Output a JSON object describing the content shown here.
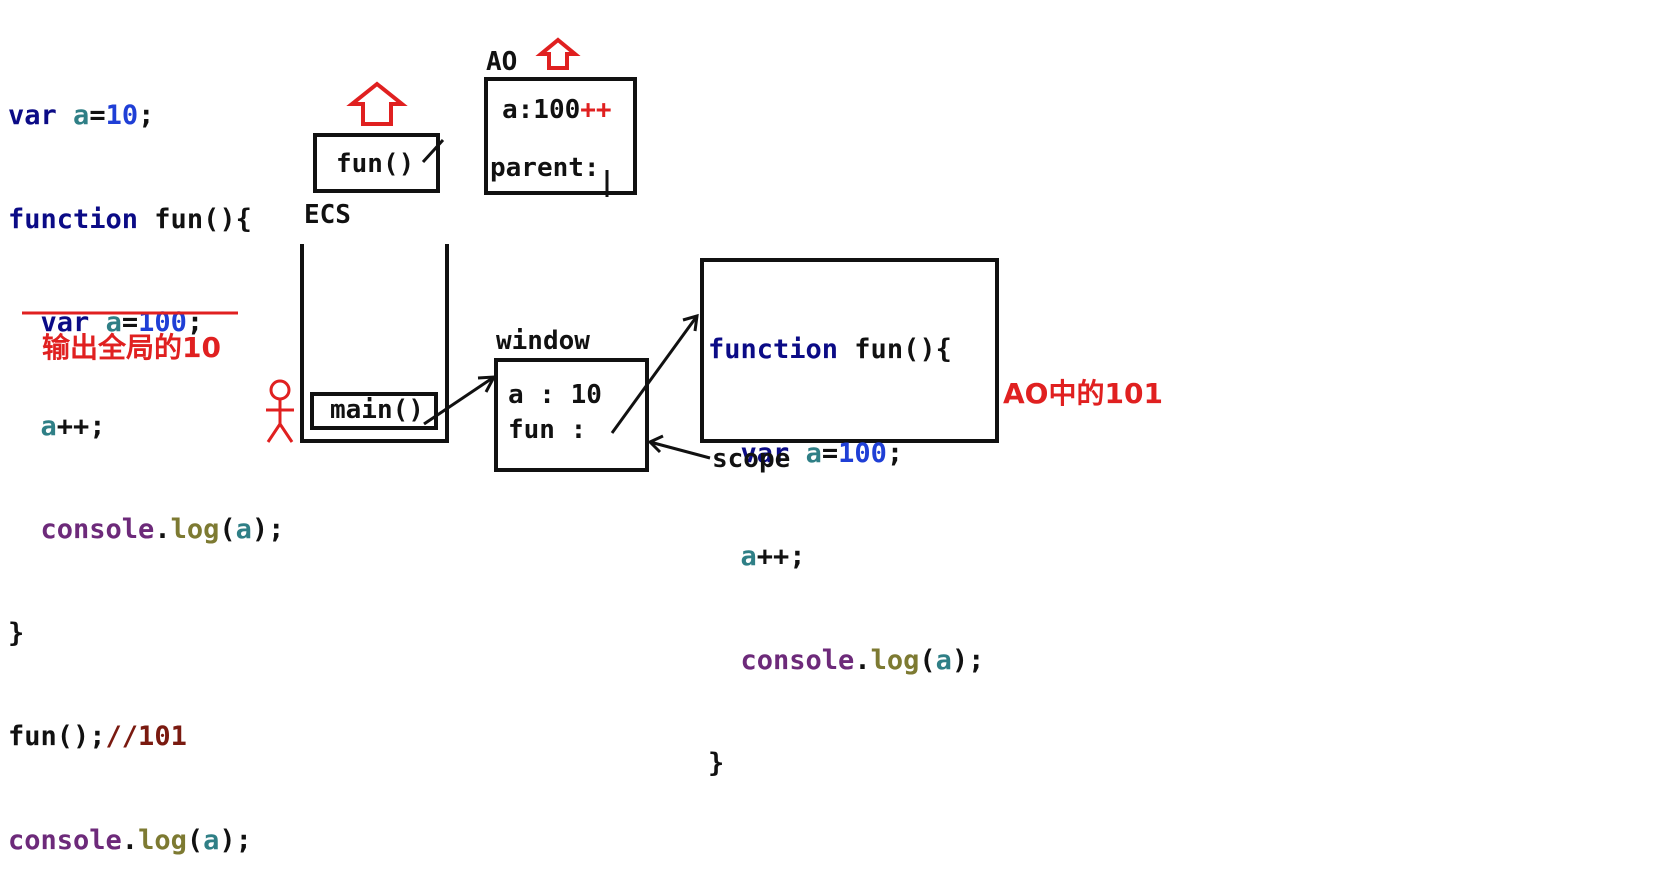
{
  "code": {
    "l1": {
      "kw": "var",
      "sp": " ",
      "v": "a",
      "eq": "=",
      "n": "10",
      "end": ";"
    },
    "l2": {
      "kw": "function",
      "rest": " fun(){"
    },
    "l3": {
      "ind": "  ",
      "kw": "var",
      "sp": " ",
      "v": "a",
      "eq": "=",
      "n": "100",
      "end": ";"
    },
    "l4": {
      "ind": "  ",
      "v": "a",
      "rest": "++;"
    },
    "l5": {
      "ind": "  ",
      "obj": "console",
      "dot": ".",
      "fn": "log",
      "p1": "(",
      "v": "a",
      "p2": ");"
    },
    "l6": "}",
    "l7": {
      "call": "fun();",
      "cmt": "//101"
    },
    "l8": {
      "obj": "console",
      "dot": ".",
      "fn": "log",
      "p1": "(",
      "v": "a",
      "p2": ");"
    }
  },
  "note_global": "输出全局的10",
  "ecs": {
    "label": "ECS",
    "top_frame": "fun()",
    "bottom_frame": "main()"
  },
  "ao": {
    "label": "AO",
    "line1_prefix": "a:100",
    "line1_suffix": "++",
    "line2": "parent:"
  },
  "window": {
    "label": "window",
    "line1": "a : 10",
    "line2": "fun :"
  },
  "func_box": {
    "l1": {
      "kw": "function",
      "rest": " fun(){"
    },
    "l2": {
      "ind": "  ",
      "kw": "var",
      "sp": " ",
      "v": "a",
      "eq": "=",
      "n": "100",
      "end": ";"
    },
    "l3": {
      "ind": "  ",
      "v": "a",
      "rest": "++;"
    },
    "l4": {
      "ind": "  ",
      "obj": "console",
      "dot": ".",
      "fn": "log",
      "p1": "(",
      "v": "a",
      "p2": ");"
    },
    "l5": "}"
  },
  "scope_label": "scope",
  "note_ao": "AO中的101",
  "colors": {
    "red": "#e02020",
    "keyword": "#0b0b86",
    "variable": "#2f7f86",
    "number": "#1f3fd6",
    "comment": "#7a1a10"
  },
  "icons": [
    "up-arrow-icon",
    "stick-figure-icon"
  ]
}
